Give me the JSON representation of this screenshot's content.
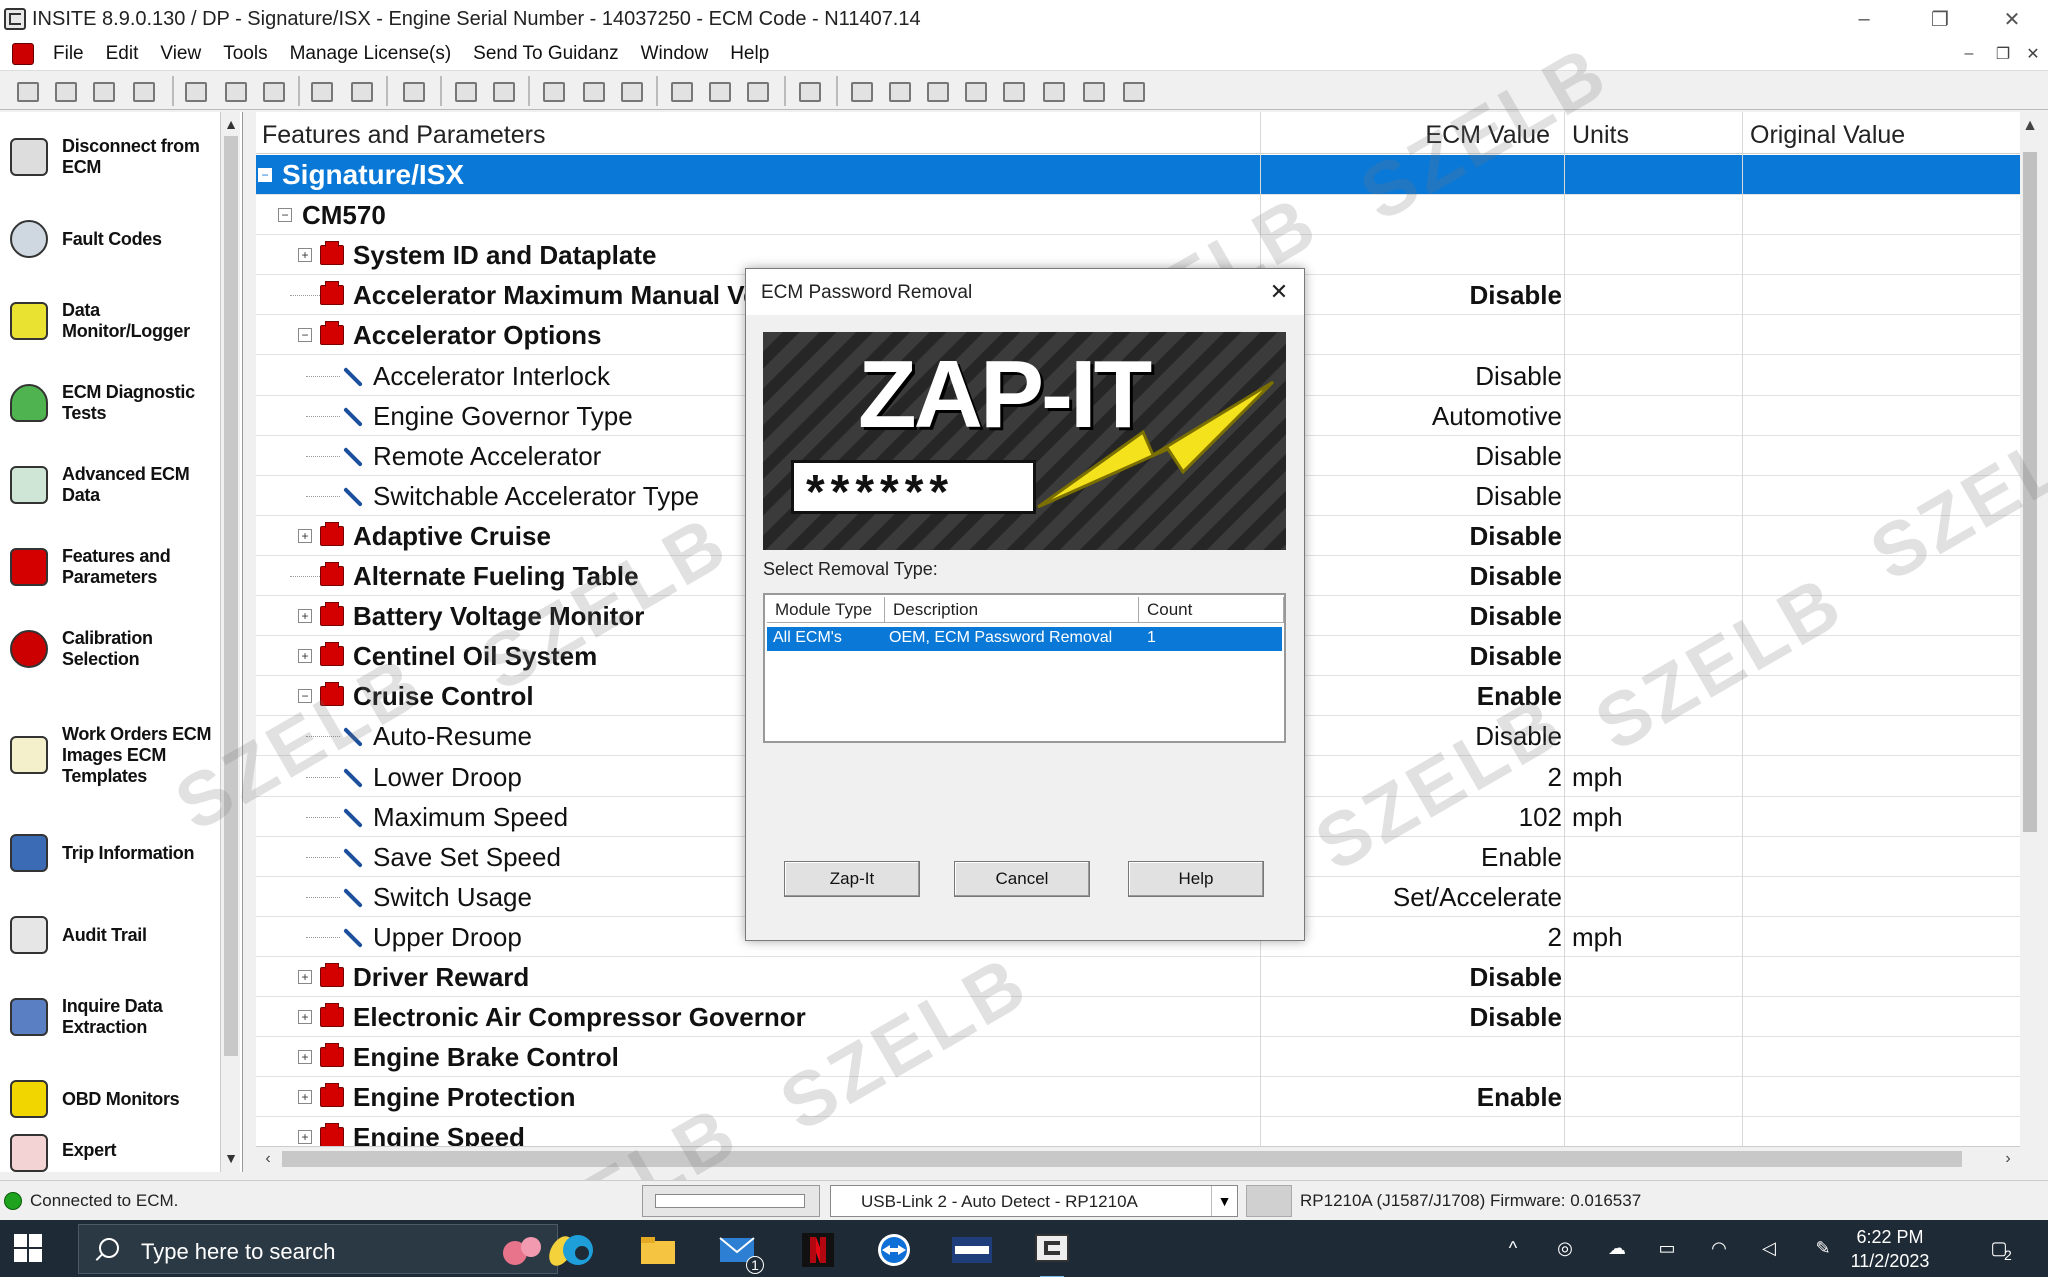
{
  "window": {
    "title": "INSITE 8.9.0.130  / DP - Signature/ISX - Engine Serial Number - 14037250 - ECM Code -  N11407.14",
    "minimize": "–",
    "restore": "❐",
    "close": "✕"
  },
  "menu": {
    "items": [
      "File",
      "Edit",
      "View",
      "Tools",
      "Manage License(s)",
      "Send To Guidanz",
      "Window",
      "Help"
    ],
    "mdi_minimize": "–",
    "mdi_restore": "❐",
    "mdi_close": "✕"
  },
  "sidebar": {
    "items": [
      {
        "label": "Disconnect from ECM",
        "icon": "connector-icon"
      },
      {
        "label": "Fault Codes",
        "icon": "fault-codes-icon"
      },
      {
        "label": "Data Monitor/Logger",
        "icon": "data-monitor-icon"
      },
      {
        "label": "ECM Diagnostic Tests",
        "icon": "flask-icon"
      },
      {
        "label": "Advanced ECM Data",
        "icon": "advanced-data-icon"
      },
      {
        "label": "Features and Parameters",
        "icon": "features-icon"
      },
      {
        "label": "Calibration Selection",
        "icon": "calibration-icon"
      },
      {
        "label": "Work Orders ECM Images ECM Templates",
        "icon": "work-orders-icon"
      },
      {
        "label": "Trip Information",
        "icon": "trip-icon"
      },
      {
        "label": "Audit Trail",
        "icon": "audit-icon"
      },
      {
        "label": "Inquire Data Extraction",
        "icon": "inquire-icon"
      },
      {
        "label": "OBD Monitors",
        "icon": "obd-icon"
      },
      {
        "label": "Expert",
        "icon": "expert-icon"
      }
    ]
  },
  "grid": {
    "columns": [
      "Features and Parameters",
      "ECM Value",
      "Units",
      "Original Value"
    ],
    "rows": [
      {
        "name": "Signature/ISX",
        "value": "",
        "unit": "",
        "kind": "root",
        "selected": true
      },
      {
        "name": "CM570",
        "value": "",
        "unit": "",
        "kind": "module"
      },
      {
        "name": "System ID and Dataplate",
        "value": "",
        "unit": "",
        "kind": "group-collapsed"
      },
      {
        "name": "Accelerator Maximum Manual Vehicle Speed",
        "value": "Disable",
        "unit": "",
        "kind": "feature"
      },
      {
        "name": "Accelerator Options",
        "value": "",
        "unit": "",
        "kind": "group-expanded"
      },
      {
        "name": "Accelerator Interlock",
        "value": "Disable",
        "unit": "",
        "kind": "param"
      },
      {
        "name": "Engine Governor Type",
        "value": "Automotive",
        "unit": "",
        "kind": "param"
      },
      {
        "name": "Remote Accelerator",
        "value": "Disable",
        "unit": "",
        "kind": "param"
      },
      {
        "name": "Switchable Accelerator Type",
        "value": "Disable",
        "unit": "",
        "kind": "param"
      },
      {
        "name": "Adaptive Cruise",
        "value": "Disable",
        "unit": "",
        "kind": "group-collapsed"
      },
      {
        "name": "Alternate Fueling Table",
        "value": "Disable",
        "unit": "",
        "kind": "feature"
      },
      {
        "name": "Battery Voltage Monitor",
        "value": "Disable",
        "unit": "",
        "kind": "group-collapsed"
      },
      {
        "name": "Centinel Oil System",
        "value": "Disable",
        "unit": "",
        "kind": "group-collapsed"
      },
      {
        "name": "Cruise Control",
        "value": "Enable",
        "unit": "",
        "kind": "group-expanded"
      },
      {
        "name": "Auto-Resume",
        "value": "Disable",
        "unit": "",
        "kind": "param"
      },
      {
        "name": "Lower Droop",
        "value": "2",
        "unit": "mph",
        "kind": "param"
      },
      {
        "name": "Maximum Speed",
        "value": "102",
        "unit": "mph",
        "kind": "param"
      },
      {
        "name": "Save Set Speed",
        "value": "Enable",
        "unit": "",
        "kind": "param"
      },
      {
        "name": "Switch Usage",
        "value": "Set/Accelerate",
        "unit": "",
        "kind": "param"
      },
      {
        "name": "Upper Droop",
        "value": "2",
        "unit": "mph",
        "kind": "param"
      },
      {
        "name": "Driver Reward",
        "value": "Disable",
        "unit": "",
        "kind": "group-collapsed"
      },
      {
        "name": "Electronic Air Compressor Governor",
        "value": "Disable",
        "unit": "",
        "kind": "group-collapsed"
      },
      {
        "name": "Engine Brake Control",
        "value": "",
        "unit": "",
        "kind": "group-collapsed"
      },
      {
        "name": "Engine Protection",
        "value": "Enable",
        "unit": "",
        "kind": "group-collapsed-locked"
      },
      {
        "name": "Engine Speed",
        "value": "",
        "unit": "",
        "kind": "group-collapsed"
      }
    ]
  },
  "dialog": {
    "title": "ECM Password Removal",
    "close": "✕",
    "banner_text": "ZAP-IT",
    "banner_password": "******",
    "select_label": "Select Removal Type:",
    "list_columns": [
      "Module Type",
      "Description",
      "Count"
    ],
    "list_rows": [
      {
        "module_type": "All ECM's",
        "description": "OEM, ECM Password Removal",
        "count": "1"
      }
    ],
    "buttons": {
      "zap": "Zap-It",
      "cancel": "Cancel",
      "help": "Help"
    }
  },
  "statusbar": {
    "connection": "Connected to ECM.",
    "adapter": "USB-Link 2 - Auto Detect - RP1210A",
    "protocol": "RP1210A (J1587/J1708)  Firmware: 0.016537"
  },
  "taskbar": {
    "search_placeholder": "Type here to search",
    "time": "6:22 PM",
    "date": "11/2/2023",
    "mail_badge": "1",
    "notification_badge": "2",
    "apps": [
      "edge-icon",
      "file-explorer-icon",
      "mail-icon",
      "netflix-icon",
      "teamviewer-icon",
      "nexiq-icon",
      "insite-icon"
    ]
  },
  "watermark": "SZELB",
  "colors": {
    "selection": "#0a78d7",
    "folder": "#d40000",
    "taskbar": "#1e2a35"
  }
}
